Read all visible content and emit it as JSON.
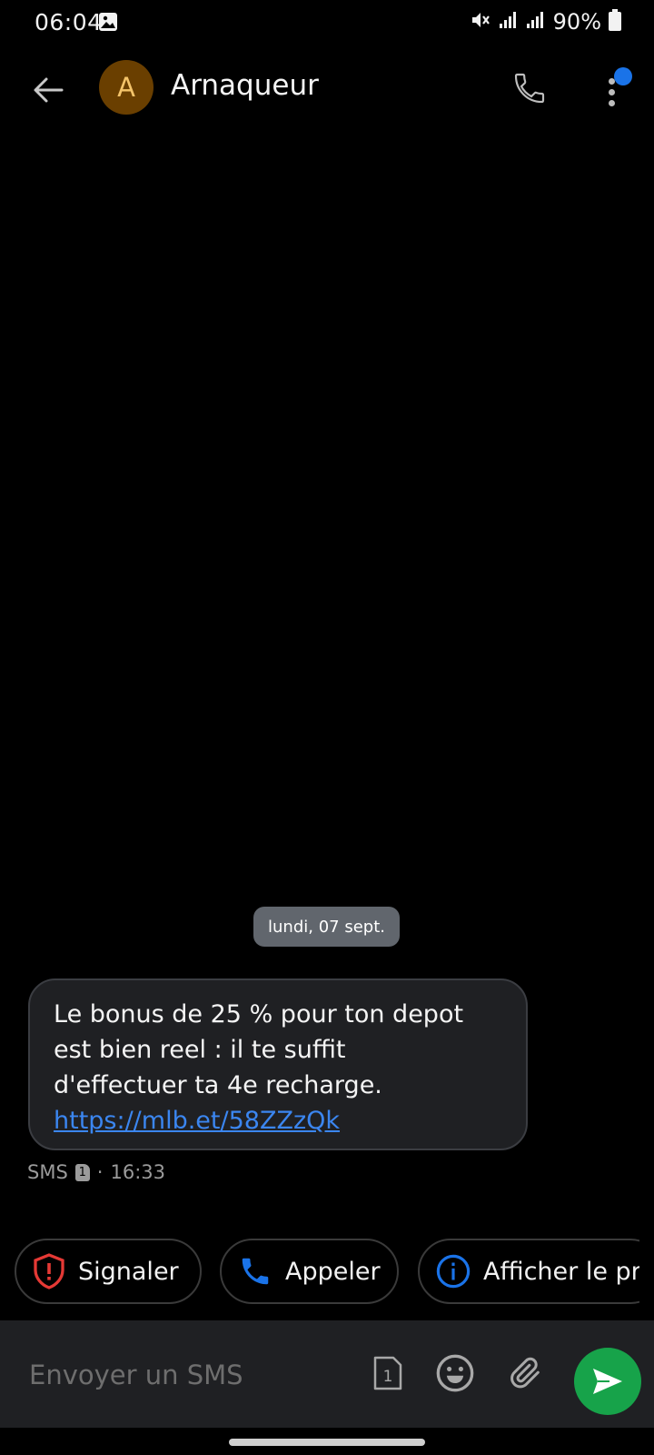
{
  "status_bar": {
    "time": "06:04",
    "battery": "90%",
    "icons": [
      "image-icon",
      "mute-icon",
      "signal-icon",
      "signal-icon",
      "battery-icon"
    ]
  },
  "header": {
    "avatar_letter": "A",
    "contact_name": "Arnaqueur",
    "avatar_color": "#6a3f00",
    "notification_color": "#1a73e8"
  },
  "conversation": {
    "date_label": "lundi, 07 sept.",
    "message": {
      "text": "Le bonus de 25 % pour ton depot\nest bien reel : il te suffit\nd'effectuer ta 4e recharge.",
      "link": "https://mlb.et/58ZZzQk",
      "type_label": "SMS",
      "sim": "1",
      "separator": "·",
      "time": "16:33"
    }
  },
  "actions": [
    {
      "label": "Signaler",
      "icon": "shield-alert-icon",
      "color": "#e53935"
    },
    {
      "label": "Appeler",
      "icon": "phone-icon",
      "color": "#1a73e8"
    },
    {
      "label": "Afficher le pr",
      "icon": "info-icon",
      "color": "#1a73e8"
    }
  ],
  "composer": {
    "placeholder": "Envoyer un SMS",
    "sim": "1",
    "send_color": "#17a34a"
  }
}
